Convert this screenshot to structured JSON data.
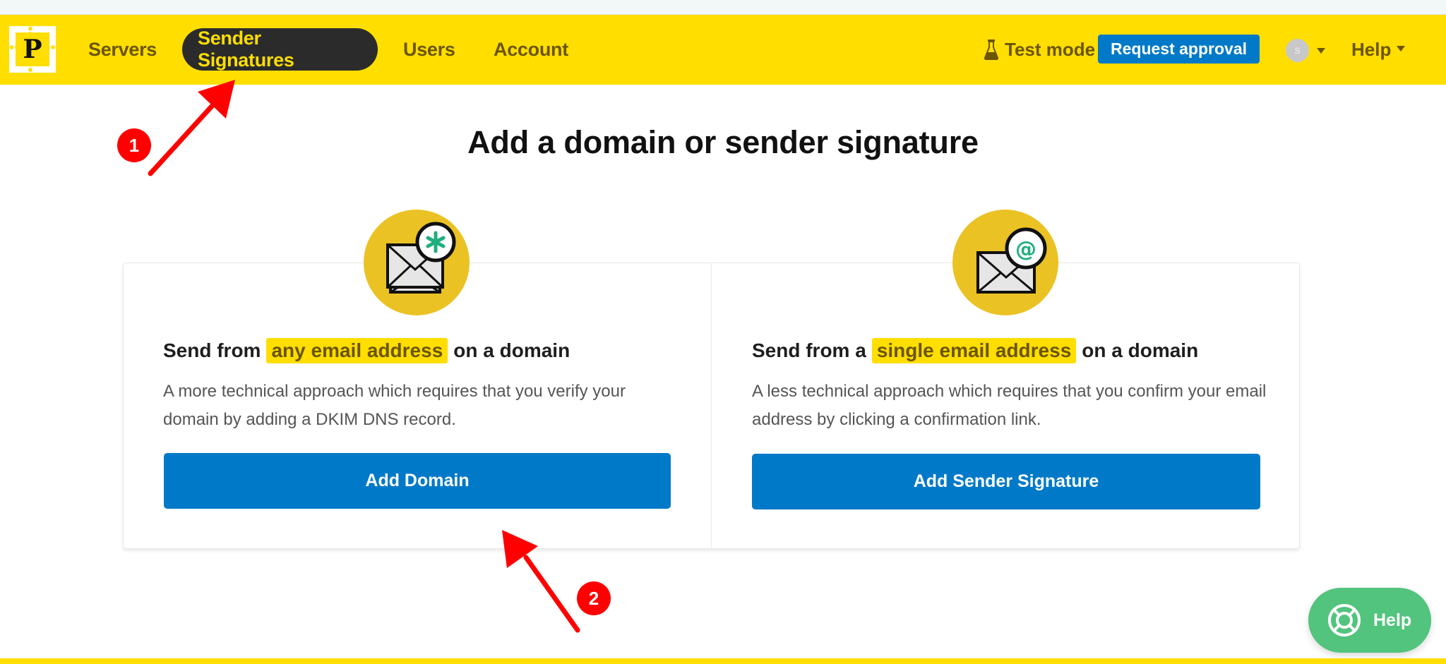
{
  "header": {
    "logo_letter": "P",
    "nav": [
      {
        "label": "Servers",
        "active": false
      },
      {
        "label": "Sender Signatures",
        "active": true
      },
      {
        "label": "Users",
        "active": false
      },
      {
        "label": "Account",
        "active": false
      }
    ],
    "test_mode_label": "Test mode",
    "request_approval_label": "Request approval",
    "avatar_initial": "S",
    "help_label": "Help"
  },
  "main": {
    "title": "Add a domain or sender signature",
    "options": [
      {
        "icon": "envelope-asterisk-icon",
        "heading_prefix": "Send from",
        "heading_highlight": "any email address",
        "heading_suffix": "on a domain",
        "description": "A more technical approach which requires that you verify your domain by adding a DKIM DNS record.",
        "button_label": "Add Domain"
      },
      {
        "icon": "envelope-at-icon",
        "heading_prefix": "Send from a",
        "heading_highlight": "single email address",
        "heading_suffix": "on a domain",
        "description": "A less technical approach which requires that you confirm your email address by clicking a confirmation link.",
        "button_label": "Add Sender Signature"
      }
    ]
  },
  "annotations": [
    {
      "number": "1",
      "target": "Sender Signatures"
    },
    {
      "number": "2",
      "target": "Add Domain"
    }
  ],
  "help_widget": {
    "label": "Help"
  },
  "colors": {
    "brand_yellow": "#ffde00",
    "primary_blue": "#0079c8",
    "help_green": "#52c47d",
    "annotation_red": "#ff0000"
  }
}
